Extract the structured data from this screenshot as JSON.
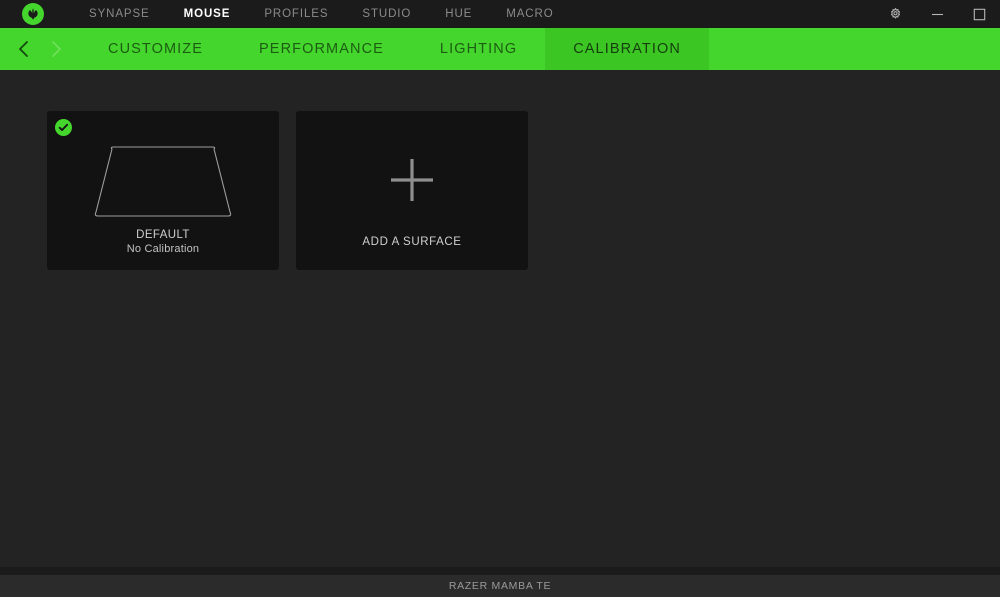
{
  "titlebar": {
    "logo_icon": "razer-logo-icon",
    "tabs": [
      {
        "label": "SYNAPSE",
        "active": false
      },
      {
        "label": "MOUSE",
        "active": true
      },
      {
        "label": "PROFILES",
        "active": false
      },
      {
        "label": "STUDIO",
        "active": false
      },
      {
        "label": "HUE",
        "active": false
      },
      {
        "label": "MACRO",
        "active": false
      }
    ],
    "window_controls": [
      {
        "name": "settings-gear-icon",
        "label": "Settings"
      },
      {
        "name": "minimize-icon",
        "label": "Minimize"
      },
      {
        "name": "maximize-icon",
        "label": "Maximize"
      }
    ]
  },
  "navbar": {
    "back_icon": "chevron-left-icon",
    "forward_icon": "chevron-right-icon",
    "tabs": [
      {
        "label": "CUSTOMIZE",
        "active": false
      },
      {
        "label": "PERFORMANCE",
        "active": false
      },
      {
        "label": "LIGHTING",
        "active": false
      },
      {
        "label": "CALIBRATION",
        "active": true
      }
    ]
  },
  "content": {
    "surfaces": [
      {
        "title": "DEFAULT",
        "subtitle": "No Calibration",
        "selected": true,
        "icon": "mousepad-surface-icon"
      }
    ],
    "add_surface": {
      "label": "ADD A SURFACE",
      "icon": "plus-icon"
    }
  },
  "statusbar": {
    "device": "RAZER MAMBA TE"
  },
  "colors": {
    "accent_green": "#44d62c",
    "accent_green_active": "#3cc624",
    "window_bg": "#232323",
    "titlebar_bg": "#1b1b1b",
    "card_bg": "#121212",
    "statusbar_bg": "#2b2b2b"
  }
}
